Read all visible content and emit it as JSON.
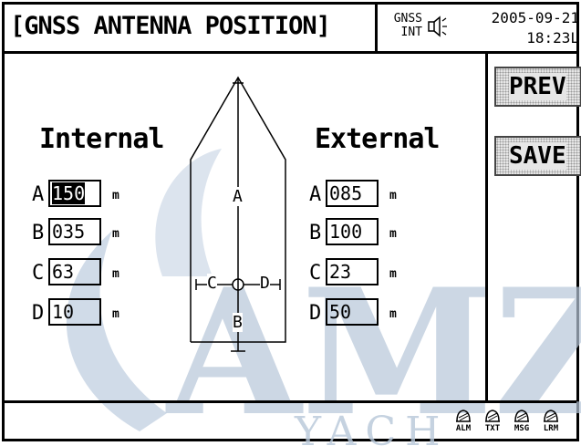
{
  "header": {
    "title": "[GNSS ANTENNA POSITION]",
    "gnss_line1": "GNSS",
    "gnss_line2": "INT",
    "speaker_icon": "speaker-icon",
    "date": "2005-09-21",
    "time": "18:23L"
  },
  "buttons": {
    "prev": "PREV",
    "save": "SAVE"
  },
  "internal": {
    "title": "Internal",
    "rows": [
      {
        "label": "A",
        "value": "150",
        "unit": "m"
      },
      {
        "label": "B",
        "value": "035",
        "unit": "m"
      },
      {
        "label": "C",
        "value": "63",
        "unit": "m"
      },
      {
        "label": "D",
        "value": "10",
        "unit": "m"
      }
    ]
  },
  "external": {
    "title": "External",
    "rows": [
      {
        "label": "A",
        "value": "085",
        "unit": "m"
      },
      {
        "label": "B",
        "value": "100",
        "unit": "m"
      },
      {
        "label": "C",
        "value": "23",
        "unit": "m"
      },
      {
        "label": "D",
        "value": "50",
        "unit": "m"
      }
    ]
  },
  "diagram": {
    "label_a": "A",
    "label_b": "B",
    "label_c": "C",
    "label_d": "D"
  },
  "footer": {
    "alarms": [
      "ALM",
      "TXT",
      "MSG",
      "LRM"
    ]
  },
  "watermark": "AMZ YACHT",
  "colors": {
    "watermark": "#b7c7d9",
    "selected_bg": "#000000"
  }
}
